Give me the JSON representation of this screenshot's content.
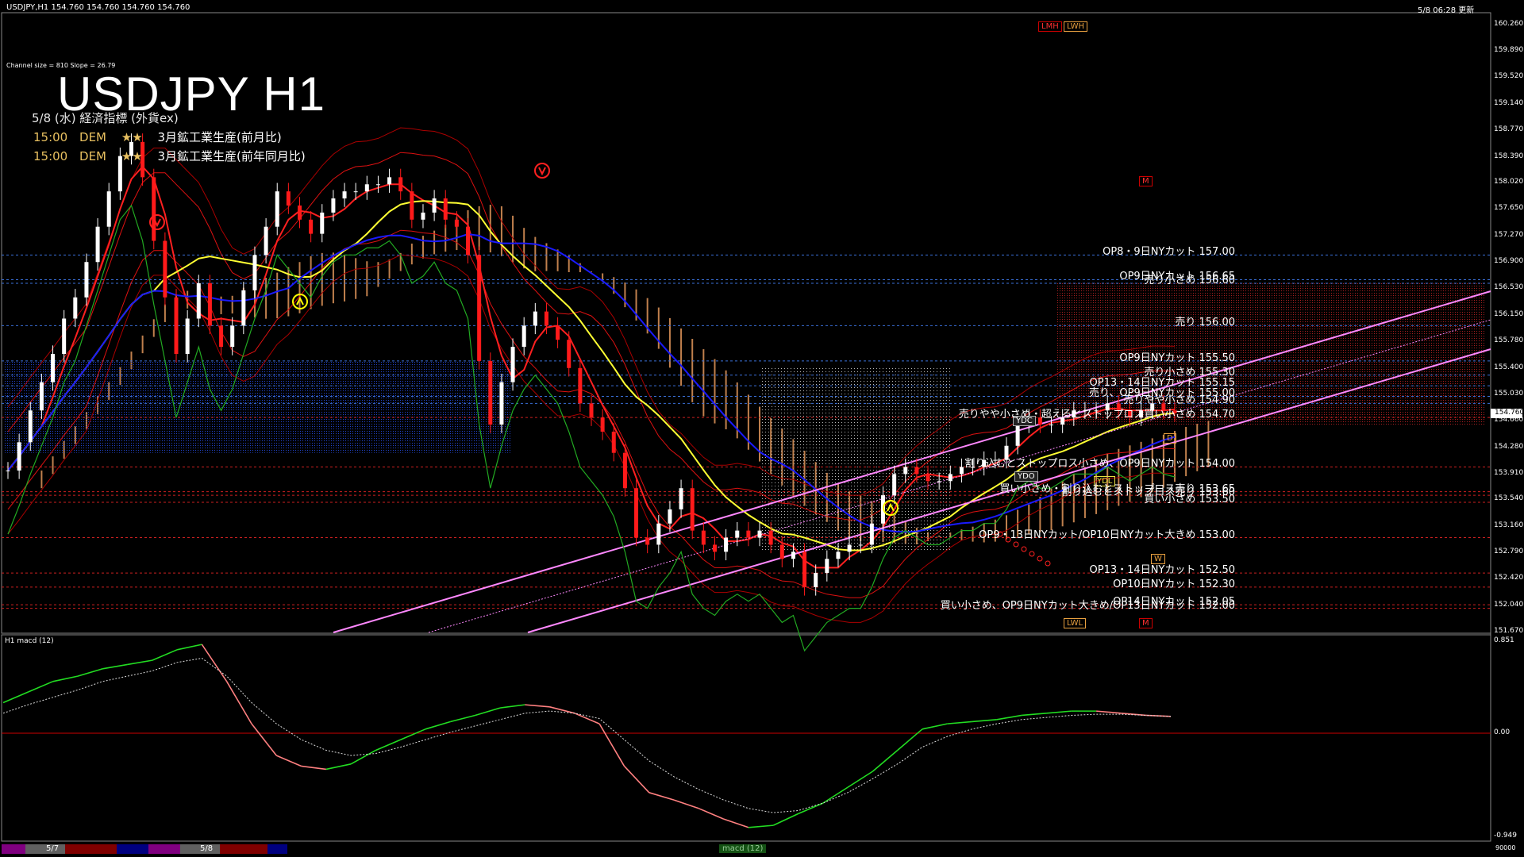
{
  "header": {
    "symbol_info": "USDJPY,H1  154.760 154.760 154.760 154.760",
    "update_time": "5/8 06:28 更新",
    "channel_info": "Channel size = 810 Slope = 26.79",
    "title": "USDJPY H1"
  },
  "economic": {
    "heading": "5/8 (水) 経済指標 (外貨ex)",
    "events": [
      {
        "time": "15:00",
        "country": "DEM",
        "stars": "★★",
        "desc": "3月鉱工業生産(前月比)"
      },
      {
        "time": "15:00",
        "country": "DEM",
        "stars": "★★",
        "desc": "3月鉱工業生産(前年同月比)"
      }
    ]
  },
  "markers": {
    "lmh": "LMH",
    "lwh": "LWH",
    "lwl": "LWL",
    "m": "M",
    "d": "D",
    "w": "W",
    "ydc": "YDC",
    "ydo": "YDO",
    "ydl": "YDL",
    "price_tag": "154.760"
  },
  "colors": {
    "up_candle": "#ffffff",
    "down_candle": "#ff1a1a",
    "ma_yellow": "#ffff33",
    "ma_blue": "#1a1aff",
    "span_green": "#22aa22",
    "band_red": "#cc0000",
    "channel": "#ff88ff",
    "cloud": "#f0a060",
    "macd_up": "#22dd22",
    "macd_down": "#ff8080"
  },
  "chart_data": [
    {
      "type": "line",
      "title": "USDJPY H1",
      "series": [
        {
          "name": "",
          "values": [
            153.95,
            154.35,
            154.8,
            155.2,
            155.6,
            156.1,
            156.4,
            156.9,
            157.4,
            157.9,
            158.4,
            158.6,
            158.1,
            157.2,
            156.4,
            155.6,
            156.1,
            156.6,
            156.0,
            155.7,
            156.0,
            156.5,
            157.0,
            157.4,
            157.9,
            157.7,
            157.5,
            157.3,
            157.6,
            157.8,
            157.9,
            157.9,
            158.0,
            158.0,
            158.1,
            157.9,
            157.5,
            157.6,
            157.8,
            157.5,
            157.4,
            157.0,
            155.5,
            154.6,
            155.2,
            155.7,
            156.0,
            156.2,
            156.0,
            155.8,
            155.4,
            154.9,
            154.7,
            154.5,
            154.2,
            153.7,
            153.0,
            152.9,
            153.2,
            153.4,
            153.7,
            153.1,
            152.9,
            152.8,
            153.0,
            153.1,
            153.0,
            153.1,
            152.9,
            152.7,
            152.8,
            152.3,
            152.5,
            152.7,
            152.8,
            152.9,
            152.9,
            153.2,
            153.6,
            153.9,
            154.0,
            153.9,
            153.8,
            153.8,
            153.9,
            154.0,
            154.0,
            154.1,
            154.1,
            154.3,
            154.6,
            154.7,
            154.6,
            154.6,
            154.7,
            154.8,
            154.8,
            154.8,
            154.9,
            154.8,
            154.7,
            154.8,
            154.9,
            154.8,
            154.76
          ]
        }
      ],
      "price_levels": [
        {
          "label": "OP8・9日NYカット 157.00",
          "price": 157.0
        },
        {
          "label": "OP9日NYカット 156.65",
          "price": 156.65
        },
        {
          "label": "売り小さめ 156.60",
          "price": 156.6
        },
        {
          "label": "売り 156.00",
          "price": 156.0
        },
        {
          "label": "OP9日NYカット 155.50",
          "price": 155.5
        },
        {
          "label": "売り小さめ 155.30",
          "price": 155.3
        },
        {
          "label": "OP13・14日NYカット 155.15",
          "price": 155.15
        },
        {
          "label": "売り、OP9日NYカット 155.00",
          "price": 155.0
        },
        {
          "label": "売りやや小さめ 154.90",
          "price": 154.9
        },
        {
          "label": "売りやや小さめ・超えるとストップロス買い小さめ 154.70",
          "price": 154.7
        },
        {
          "label": "割り込むとストップロス小さめ、OP9日NYカット 154.00",
          "price": 154.0
        },
        {
          "label": "買い小さめ・割り込むとストップロス売り 153.65",
          "price": 153.65
        },
        {
          "label": "割り込むとストップロス売り 153.60",
          "price": 153.6
        },
        {
          "label": "買い小さめ 153.50",
          "price": 153.5
        },
        {
          "label": "OP9・13日NYカット/OP10日NYカット大きめ 153.00",
          "price": 153.0
        },
        {
          "label": "OP13・14日NYカット 152.50",
          "price": 152.5
        },
        {
          "label": "OP10日NYカット 152.30",
          "price": 152.3
        },
        {
          "label": "OP14日NYカット 152.05",
          "price": 152.05
        },
        {
          "label": "買い小さめ、OP9日NYカット大きめ/OP13日NYカット 152.00",
          "price": 152.0
        }
      ],
      "y_ticks": [
        "160.260",
        "159.890",
        "159.520",
        "159.140",
        "158.770",
        "158.390",
        "158.020",
        "157.650",
        "157.270",
        "156.900",
        "156.530",
        "156.150",
        "155.780",
        "155.400",
        "155.030",
        "154.660",
        "154.280",
        "153.910",
        "153.540",
        "153.160",
        "152.790",
        "152.420",
        "152.040",
        "151.670"
      ],
      "ylim": [
        151.67,
        160.26
      ],
      "grid": false
    },
    {
      "type": "line",
      "title": "H1  macd (12)",
      "series": [
        {
          "name": "",
          "values": [
            0.3,
            0.4,
            0.5,
            0.55,
            0.62,
            0.66,
            0.7,
            0.8,
            0.85,
            0.5,
            0.1,
            -0.2,
            -0.3,
            -0.33,
            -0.28,
            -0.15,
            -0.05,
            0.05,
            0.12,
            0.18,
            0.25,
            0.28,
            0.26,
            0.2,
            0.1,
            -0.3,
            -0.55,
            -0.62,
            -0.7,
            -0.8,
            -0.88,
            -0.86,
            -0.75,
            -0.65,
            -0.5,
            -0.35,
            -0.15,
            0.05,
            0.1,
            0.12,
            0.14,
            0.18,
            0.2,
            0.22,
            0.22,
            0.2,
            0.18,
            0.17
          ]
        },
        {
          "name": "",
          "values": [
            0.2,
            0.28,
            0.35,
            0.42,
            0.5,
            0.55,
            0.6,
            0.68,
            0.72,
            0.55,
            0.3,
            0.1,
            -0.05,
            -0.15,
            -0.2,
            -0.18,
            -0.12,
            -0.05,
            0.02,
            0.08,
            0.14,
            0.2,
            0.22,
            0.2,
            0.15,
            -0.05,
            -0.25,
            -0.4,
            -0.52,
            -0.62,
            -0.7,
            -0.74,
            -0.72,
            -0.65,
            -0.55,
            -0.42,
            -0.28,
            -0.12,
            -0.02,
            0.05,
            0.1,
            0.14,
            0.16,
            0.18,
            0.19,
            0.19,
            0.18,
            0.17
          ]
        }
      ],
      "y_ticks": [
        "0.851",
        "0.00",
        "-0.949"
      ],
      "ylim": [
        -0.949,
        0.851
      ]
    }
  ],
  "bottom_strip": {
    "date1": "5/7",
    "date2": "5/8",
    "label": "macd (12)",
    "right": "90000"
  }
}
